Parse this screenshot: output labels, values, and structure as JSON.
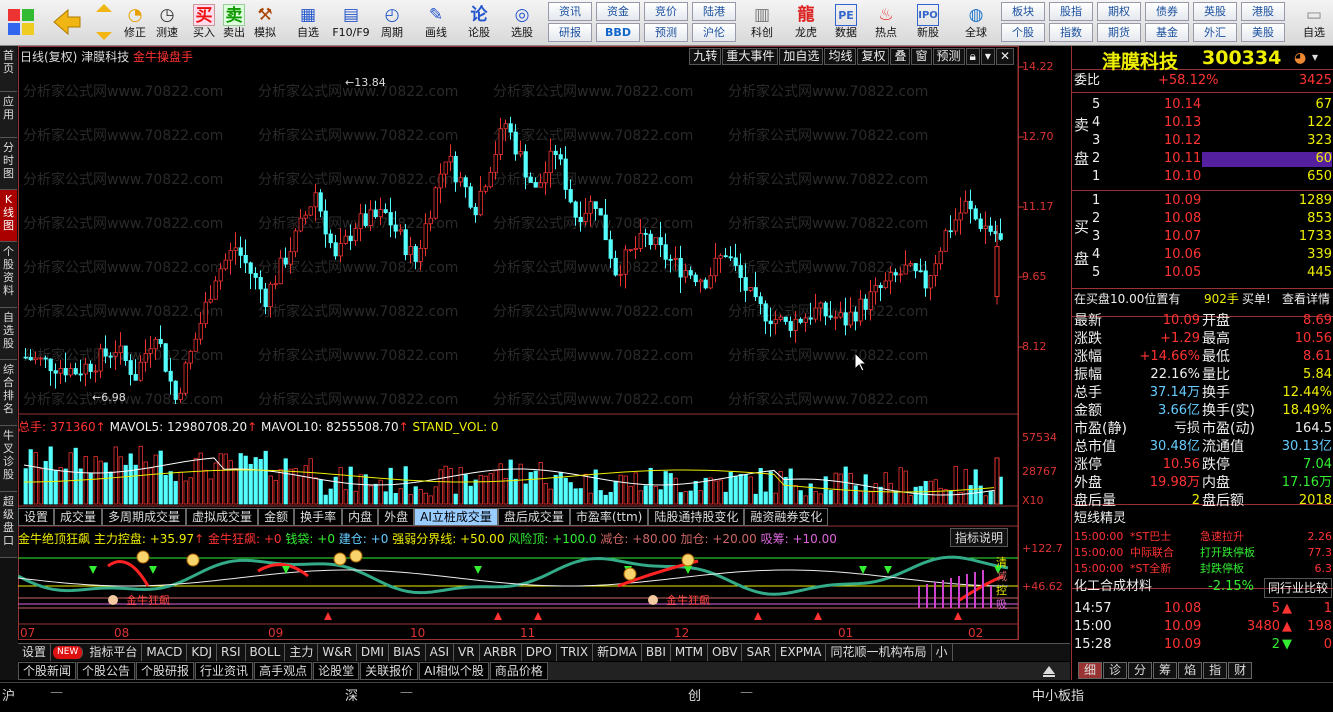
{
  "toolbar": {
    "big": [
      "修正",
      "测速",
      "买入",
      "卖出",
      "模拟",
      "自选",
      "F10/F9",
      "周期",
      "画线",
      "论股",
      "选股"
    ],
    "small_top": [
      "资讯",
      "资金",
      "竞价",
      "陆港"
    ],
    "small_bot": [
      "研报",
      "BBD",
      "预测",
      "沪伦"
    ],
    "mid": [
      "科创",
      "龙虎",
      "数据",
      "热点",
      "新股"
    ],
    "global": "全球",
    "right_top": [
      "板块",
      "股指",
      "期权",
      "债券",
      "英股",
      "港股"
    ],
    "right_bot": [
      "个股",
      "指数",
      "期货",
      "基金",
      "外汇",
      "美股"
    ],
    "edge": "自选"
  },
  "sidebar": [
    "首页",
    "应用",
    "分时图",
    "K线图",
    "个股资料",
    "自选股",
    "综合排名",
    "牛叉诊股",
    "超级盘口"
  ],
  "chart": {
    "header_left": "日线(复权)",
    "stock": "津膜科技",
    "indicator": "金牛操盘手",
    "buttons": [
      "九转",
      "重大事件",
      "加自选",
      "均线",
      "复权",
      "叠",
      "窗",
      "预测"
    ],
    "price_axis": [
      "14.22",
      "12.70",
      "11.17",
      "9.65",
      "8.12"
    ],
    "high_label": "13.84",
    "low_label": "6.98",
    "watermark": "分析家公式网www.70822.com",
    "vol_header": {
      "total": "总手: 371360",
      "ma5": "MAVOL5: 12980708.20",
      "ma10": "MAVOL10: 8255508.70",
      "stand": "STAND_VOL: 0"
    },
    "vol_axis": [
      "57534",
      "28767",
      "X10"
    ],
    "tabs1": [
      "设置",
      "成交量",
      "多周期成交量",
      "虚拟成交量",
      "金额",
      "换手率",
      "内盘",
      "外盘",
      "AI立桩成交量",
      "盘后成交量",
      "市盈率(ttm)",
      "陆股通持股变化",
      "融资融券变化"
    ],
    "ind_header": {
      "name": "金牛绝顶狂飙",
      "zl": "主力控盘: +35.97",
      "kb": "金牛狂飙: +0",
      "qd": "钱袋: +0",
      "jc": "建仓: +0",
      "qr": "强弱分界线: +50.00",
      "fx": "风险顶: +100.0",
      "jian": "减仓: +80.00",
      "jia": "加仓: +20.00",
      "xc": "吸筹: +10.00"
    },
    "explain": "指标说明",
    "ind_axis": [
      "+122.7",
      "+46.62"
    ],
    "ind_side": [
      "清",
      "减",
      "控",
      "吸"
    ],
    "ind_labels": [
      "金牛狂飙",
      "金牛狂飙"
    ],
    "months": [
      "07",
      "08",
      "09",
      "10",
      "11",
      "12",
      "01",
      "02"
    ]
  },
  "tabs2": [
    "设置",
    "NEW",
    "指标平台",
    "MACD",
    "KDJ",
    "RSI",
    "BOLL",
    "主力",
    "W&R",
    "DMI",
    "BIAS",
    "ASI",
    "VR",
    "ARBR",
    "DPO",
    "TRIX",
    "新DMA",
    "BBI",
    "MTM",
    "OBV",
    "SAR",
    "EXPMA",
    "同花顺一机构布局",
    "小"
  ],
  "tabs3": [
    "个股新闻",
    "个股公告",
    "个股研报",
    "行业资讯",
    "高手观点",
    "论股堂",
    "关联报价",
    "AI相似个股",
    "商品价格"
  ],
  "status": [
    "沪",
    "深",
    "创",
    "中小板指"
  ],
  "panel": {
    "name": "津膜科技",
    "code": "300334",
    "weibi_label": "委比",
    "weibi": "+58.12%",
    "weicha": "3425",
    "sell": [
      {
        "lv": "5",
        "price": "10.14",
        "vol": "67"
      },
      {
        "lv": "4",
        "price": "10.13",
        "vol": "122"
      },
      {
        "lv": "3",
        "price": "10.12",
        "vol": "323"
      },
      {
        "lv": "2",
        "price": "10.11",
        "vol": "60"
      },
      {
        "lv": "1",
        "price": "10.10",
        "vol": "650"
      }
    ],
    "buy": [
      {
        "lv": "1",
        "price": "10.09",
        "vol": "1289"
      },
      {
        "lv": "2",
        "price": "10.08",
        "vol": "853"
      },
      {
        "lv": "3",
        "price": "10.07",
        "vol": "1733"
      },
      {
        "lv": "4",
        "price": "10.06",
        "vol": "339"
      },
      {
        "lv": "5",
        "price": "10.05",
        "vol": "445"
      }
    ],
    "sell_label": [
      "卖",
      "盘"
    ],
    "buy_label": [
      "买",
      "盘"
    ],
    "queue": {
      "text": "在买盘10.00位置有",
      "vol": "902手",
      "action": "买单!",
      "link": "查看详情"
    },
    "quote": [
      {
        "l": "最新",
        "v": "10.09",
        "l2": "开盘",
        "v2": "8.69"
      },
      {
        "l": "涨跌",
        "v": "+1.29",
        "l2": "最高",
        "v2": "10.56"
      },
      {
        "l": "涨幅",
        "v": "+14.66%",
        "l2": "最低",
        "v2": "8.61"
      },
      {
        "l": "振幅",
        "v": "22.16%",
        "l2": "量比",
        "v2": "5.84"
      },
      {
        "l": "总手",
        "v": "37.14万",
        "l2": "换手",
        "v2": "12.44%"
      },
      {
        "l": "金额",
        "v": "3.66亿",
        "l2": "换手(实)",
        "v2": "18.49%"
      },
      {
        "l": "市盈(静)",
        "v": "亏损",
        "l2": "市盈(动)",
        "v2": "164.5"
      },
      {
        "l": "总市值",
        "v": "30.48亿",
        "l2": "流通值",
        "v2": "30.13亿"
      },
      {
        "l": "涨停",
        "v": "10.56",
        "l2": "跌停",
        "v2": "7.04"
      },
      {
        "l": "外盘",
        "v": "19.98万",
        "l2": "内盘",
        "v2": "17.16万"
      },
      {
        "l": "盘后量",
        "v": "2",
        "l2": "盘后额",
        "v2": "2018"
      }
    ],
    "elf_title": "短线精灵",
    "elf": [
      {
        "t": "15:00:00",
        "s": "*ST巴士",
        "e": "急速拉升",
        "v": "2.26"
      },
      {
        "t": "15:00:00",
        "s": "中际联合",
        "e": "打开跌停板",
        "v": "77.3"
      },
      {
        "t": "15:00:00",
        "s": "*ST全新",
        "e": "封跌停板",
        "v": "6.3"
      }
    ],
    "sector": {
      "name": "化工合成材料",
      "chg": "-2.15%",
      "link": "同行业比较"
    },
    "ticks": [
      {
        "t": "14:57",
        "p": "10.08",
        "v": "5",
        "d": "up",
        "x": "1"
      },
      {
        "t": "15:00",
        "p": "10.09",
        "v": "3480",
        "d": "up",
        "x": "198"
      },
      {
        "t": "15:28",
        "p": "10.09",
        "v": "2",
        "d": "dn",
        "x": "0"
      }
    ],
    "bottom_tabs": [
      "细",
      "诊",
      "分",
      "筹",
      "焰",
      "指",
      "财"
    ]
  }
}
